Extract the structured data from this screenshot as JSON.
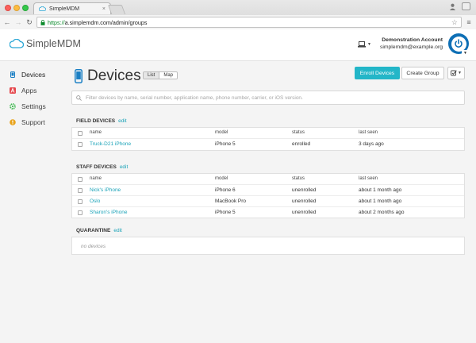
{
  "browser": {
    "tab_title": "SimpleMDM",
    "tab_close": "×",
    "url_scheme": "https://",
    "url_rest": "a.simplemdm.com/admin/groups"
  },
  "header": {
    "logo_simple": "Simple",
    "logo_mdm": "MDM",
    "account_name": "Demonstration Account",
    "account_email": "simplemdm@example.org"
  },
  "sidebar": {
    "items": [
      {
        "label": "Devices",
        "icon": "phone-icon",
        "color": "#1a7fc4"
      },
      {
        "label": "Apps",
        "icon": "apps-icon",
        "color": "#e5484d"
      },
      {
        "label": "Settings",
        "icon": "settings-icon",
        "color": "#3fb950"
      },
      {
        "label": "Support",
        "icon": "support-icon",
        "color": "#e8a21a"
      }
    ]
  },
  "main": {
    "title": "Devices",
    "view_list": "List",
    "view_map": "Map",
    "enroll_label": "Enroll Devices",
    "create_group_label": "Create Group",
    "search_placeholder": "Filter devices by name, serial number, application name, phone number, carrier, or iOS version.",
    "columns": {
      "name": "name",
      "model": "model",
      "status": "status",
      "last_seen": "last seen"
    },
    "edit_label": "edit",
    "groups": [
      {
        "title": "FIELD DEVICES",
        "devices": [
          {
            "name": "Truck-D21 iPhone",
            "model": "iPhone 5",
            "status": "enrolled",
            "last_seen": "3 days ago"
          }
        ]
      },
      {
        "title": "STAFF DEVICES",
        "devices": [
          {
            "name": "Nick's iPhone",
            "model": "iPhone 6",
            "status": "unenrolled",
            "last_seen": "about 1 month ago"
          },
          {
            "name": "Oslo",
            "model": "MacBook Pro",
            "status": "unenrolled",
            "last_seen": "about 1 month ago"
          },
          {
            "name": "Sharon's iPhone",
            "model": "iPhone 5",
            "status": "unenrolled",
            "last_seen": "about 2 months ago"
          }
        ]
      },
      {
        "title": "QUARANTINE",
        "empty_text": "no devices"
      }
    ]
  },
  "colors": {
    "accent": "#23b6c8",
    "link": "#1ba3b8",
    "brand_blue": "#0e6fb5"
  }
}
